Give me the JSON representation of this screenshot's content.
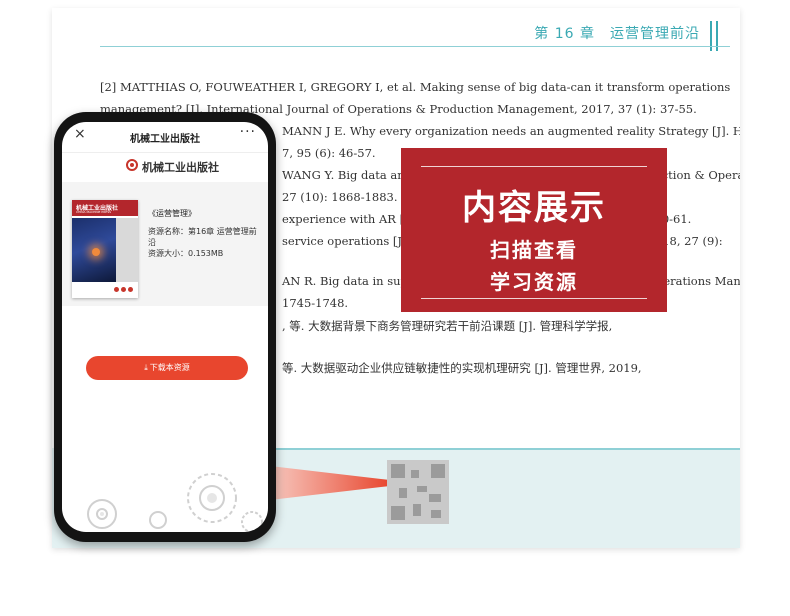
{
  "book": {
    "header": "第 16 章　运营管理前沿",
    "refs": [
      {
        "text": "[2] MATTHIAS O, FOUWEATHER I, GREGORY I, et al. Making sense of big data-can it transform operations",
        "indent": false
      },
      {
        "text": "management? [J]. International Journal of Operations & Production Management, 2017, 37 (1): 37-55.",
        "indent": false
      },
      {
        "text": "MANN J E. Why every organization needs an augmented reality Strategy [J]. Har-",
        "indent": true
      },
      {
        "text": "7, 95 (6): 46-57.",
        "indent": true
      },
      {
        "text": "WANG Y. Big data analytics in operations management [J]. Production & Opera-",
        "indent": true
      },
      {
        "text": "27 (10): 1868-1883.",
        "indent": true
      },
      {
        "text": "experience with AR [J]. Harvard Business Review, 2017, 95 (6), 60-61.",
        "indent": true
      },
      {
        "text": "service operations [J]. Production & Operations Management, 2018, 27 (9):",
        "indent": true
      },
      {
        "text": "AN R. Big data in supply chain management [J]. Production & Operations Man-",
        "indent": true
      },
      {
        "text": "1745-1748.",
        "indent": true
      },
      {
        "text": ", 等. 大数据背景下商务管理研究若干前沿课题 [J]. 管理科学学报,",
        "indent": true
      },
      {
        "text": "等. 大数据驱动企业供应链敏捷性的实现机理研究 [J]. 管理世界, 2019,",
        "indent": true
      }
    ]
  },
  "promo": {
    "title": "内容展示",
    "line1": "扫描查看",
    "line2": "学习资源",
    "color": "#b3262c"
  },
  "phone": {
    "topbar_title": "机械工业出版社",
    "close_icon": "×",
    "more_icon": "···",
    "brand_name": "机械工业出版社",
    "cover_title": "机械工业出版社",
    "cover_sub": "CHINA MACHINE PRESS",
    "book_name": "《运营管理》",
    "resource_name": "资源名称：第16章 运营管理前",
    "resource_name_cont": "沿",
    "resource_size": "资源大小：0.153MB",
    "download_label": "下载本资源",
    "download_icon": "⤓",
    "accent": "#e8462e"
  }
}
